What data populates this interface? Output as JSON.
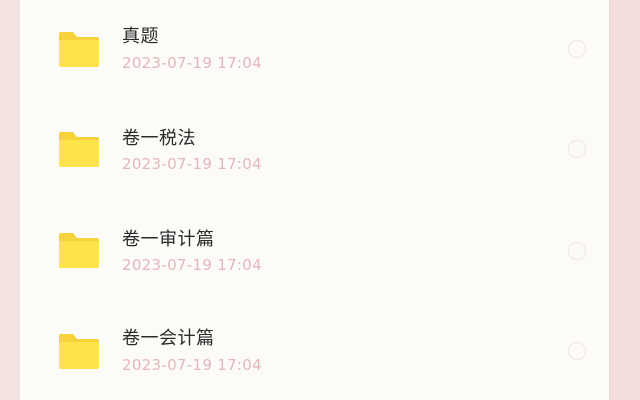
{
  "files": [
    {
      "name": "真题",
      "time": "2023-07-19 17:04",
      "icon": "folder-icon"
    },
    {
      "name": "卷一税法",
      "time": "2023-07-19 17:04",
      "icon": "folder-icon"
    },
    {
      "name": "卷一审计篇",
      "time": "2023-07-19 17:04",
      "icon": "folder-icon"
    },
    {
      "name": "卷一会计篇",
      "time": "2023-07-19 17:04",
      "icon": "folder-icon"
    }
  ],
  "colors": {
    "folder": "#ffe34a",
    "folder_tab": "#f7d33a",
    "timestamp": "#e3b7b9",
    "title": "#2b2b2b",
    "panel": "#fdfbf8",
    "background": "#efd9d6"
  }
}
